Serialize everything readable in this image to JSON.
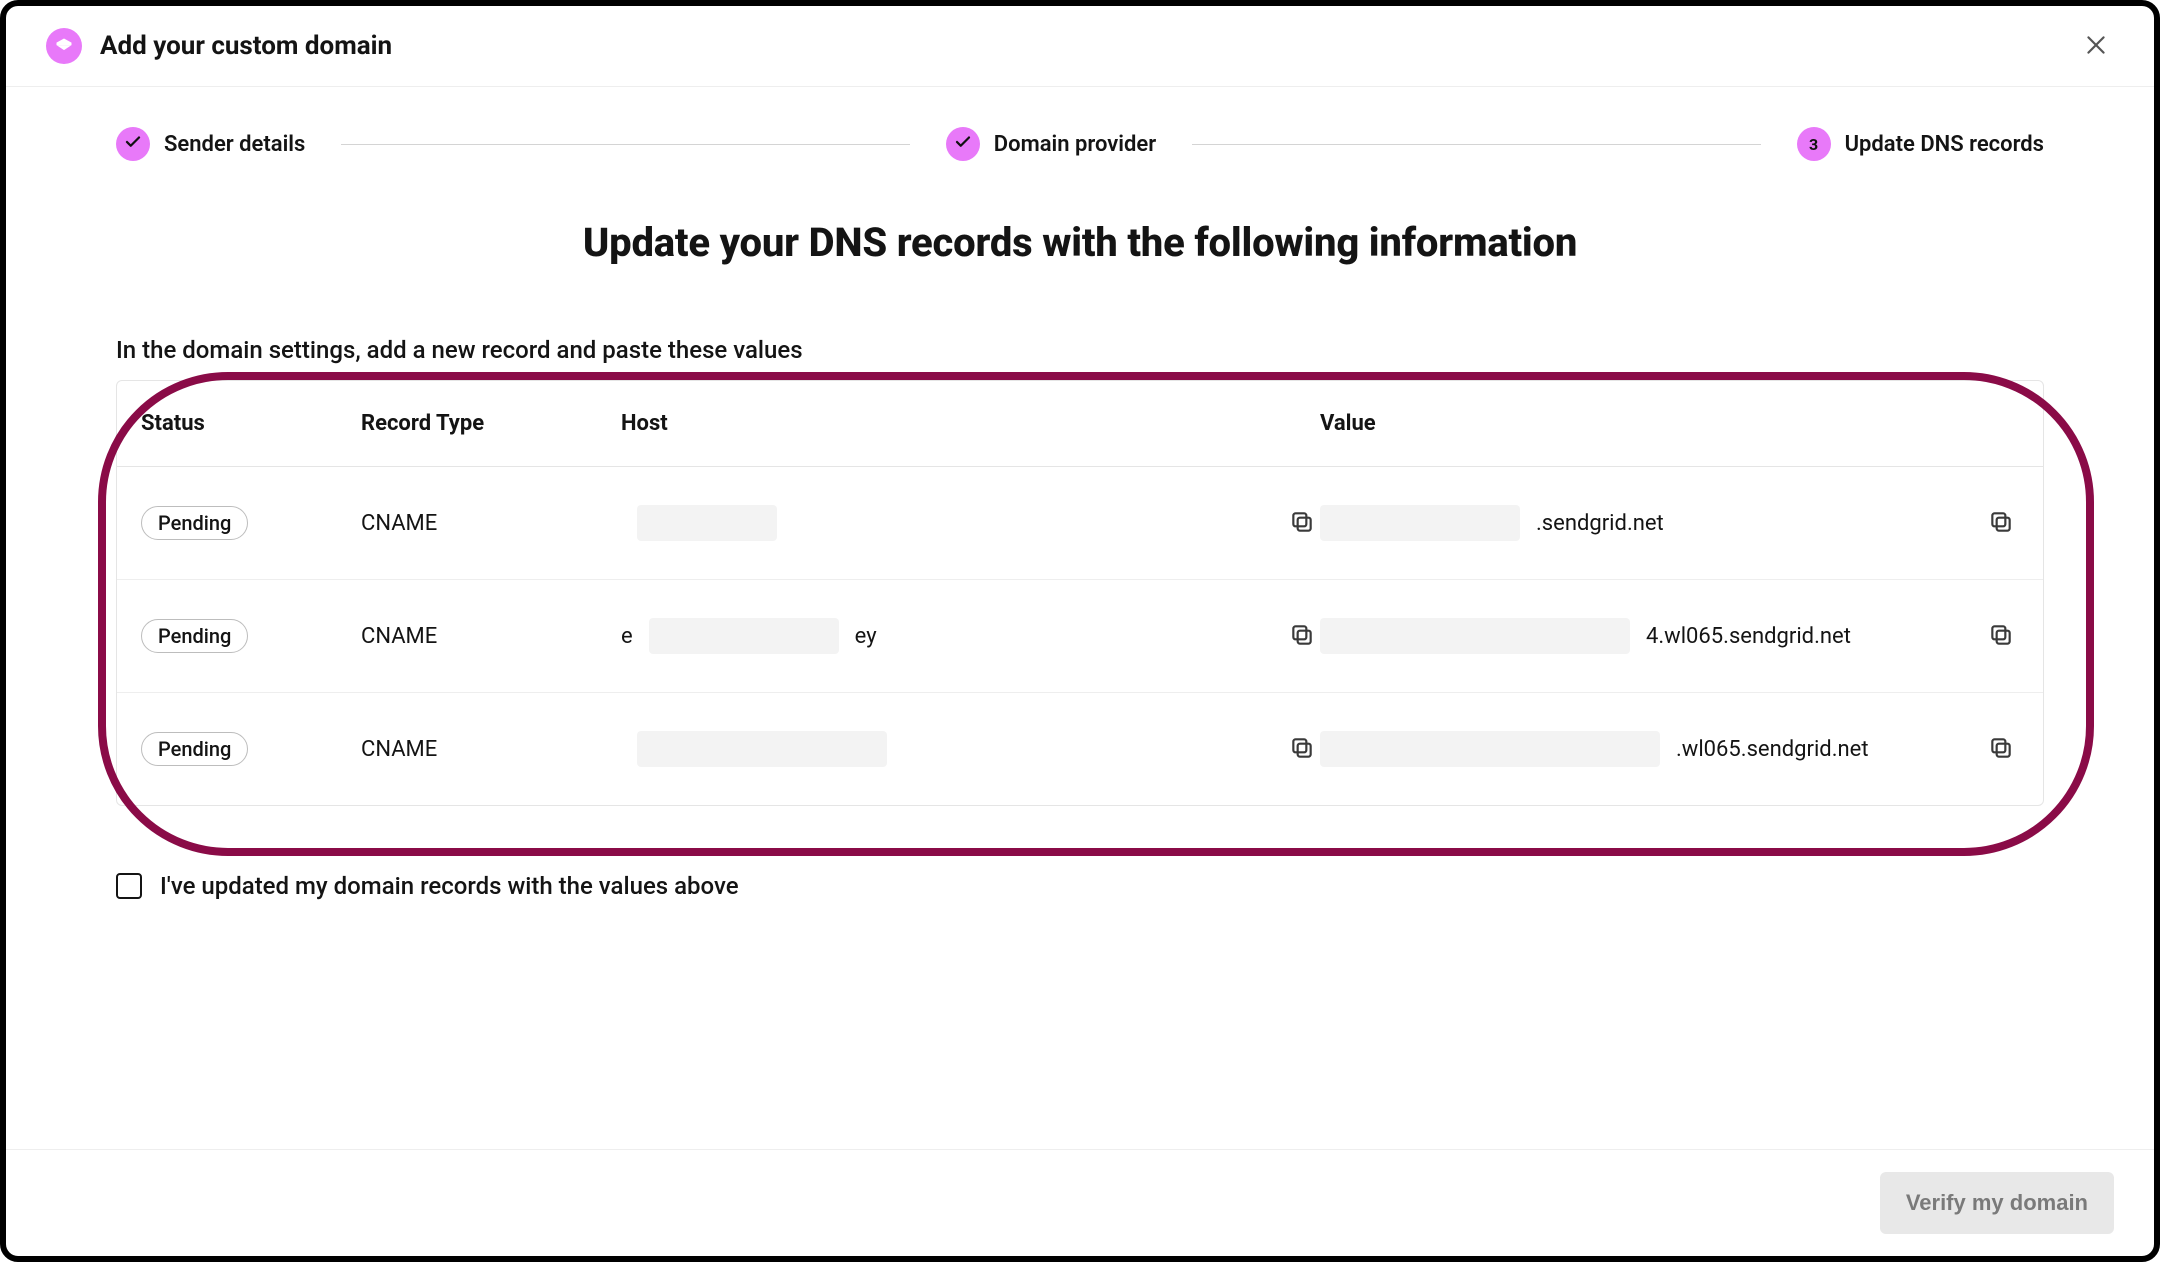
{
  "header": {
    "title": "Add your custom domain"
  },
  "stepper": {
    "steps": [
      {
        "label": "Sender details",
        "badge": "✓",
        "done": true
      },
      {
        "label": "Domain provider",
        "badge": "✓",
        "done": true
      },
      {
        "label": "Update DNS records",
        "badge": "3",
        "done": false
      }
    ]
  },
  "page": {
    "title": "Update your DNS records with the following information",
    "intro": "In the domain settings, add a new record and paste these values"
  },
  "table": {
    "columns": {
      "status": "Status",
      "record_type": "Record Type",
      "host": "Host",
      "value": "Value"
    },
    "rows": [
      {
        "status": "Pending",
        "record_type": "CNAME",
        "host_visible_prefix": "",
        "host_visible_suffix": "",
        "value_visible_suffix": ".sendgrid.net"
      },
      {
        "status": "Pending",
        "record_type": "CNAME",
        "host_visible_prefix": "e",
        "host_visible_suffix": "ey",
        "value_visible_suffix": "4.wl065.sendgrid.net"
      },
      {
        "status": "Pending",
        "record_type": "CNAME",
        "host_visible_prefix": "",
        "host_visible_suffix": "",
        "value_visible_suffix": ".wl065.sendgrid.net"
      }
    ]
  },
  "confirm": {
    "label": "I've updated my domain records with the values above",
    "checked": false
  },
  "footer": {
    "verify_label": "Verify my domain",
    "verify_enabled": false
  },
  "annotation": {
    "highlight_table": true
  }
}
